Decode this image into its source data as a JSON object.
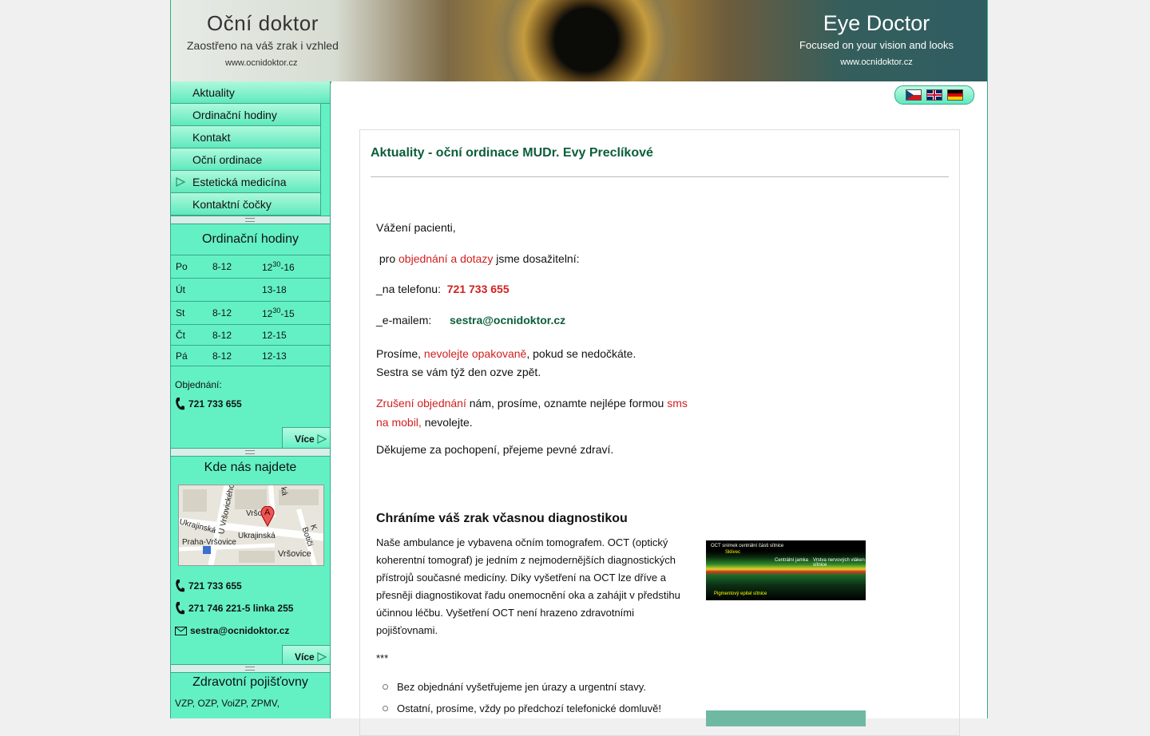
{
  "banner": {
    "left_title": "Oční doktor",
    "left_subtitle": "Zaostřeno na váš zrak i vzhled",
    "left_url": "www.ocnidoktor.cz",
    "right_title": "Eye Doctor",
    "right_subtitle": "Focused on your vision and looks",
    "right_url": "www.ocnidoktor.cz"
  },
  "menu": {
    "items": [
      {
        "label": "Aktuality"
      },
      {
        "label": "Ordinační hodiny"
      },
      {
        "label": "Kontakt"
      },
      {
        "label": "Oční ordinace"
      },
      {
        "label": "Estetická medicína"
      },
      {
        "label": "Kontaktní čočky"
      }
    ]
  },
  "hours_box": {
    "title": "Ordinační hodiny",
    "rows": [
      {
        "day": "Po",
        "morning": "8-12",
        "afternoon_base": "12",
        "afternoon_sup": "30",
        "afternoon_end": "-16"
      },
      {
        "day": "Út",
        "morning": "",
        "afternoon_base": "13-18",
        "afternoon_sup": "",
        "afternoon_end": ""
      },
      {
        "day": "St",
        "morning": "8-12",
        "afternoon_base": "12",
        "afternoon_sup": "30",
        "afternoon_end": "-15"
      },
      {
        "day": "Čt",
        "morning": "8-12",
        "afternoon_base": "12-15",
        "afternoon_sup": "",
        "afternoon_end": ""
      },
      {
        "day": "Pá",
        "morning": "8-12",
        "afternoon_base": "12-13",
        "afternoon_sup": "",
        "afternoon_end": ""
      }
    ],
    "order_label": "Objednání:",
    "order_phone": "721 733 655",
    "more_label": "Více"
  },
  "location_box": {
    "title": "Kde nás najdete",
    "map_labels": {
      "street1": "U Vršovického",
      "street2": "Vršo",
      "street3": "Ukrajinská",
      "street4": "Ukrajinská",
      "street5": "Praha-Vršovice",
      "street6": "Vršovice",
      "street7": "K Botiči",
      "street8": "ká",
      "marker": "A"
    },
    "phone1": "721 733 655",
    "phone2": "271 746 221-5 linka 255",
    "email": "sestra@ocnidoktor.cz",
    "more_label": "Více"
  },
  "insurance_box": {
    "title": "Zdravotní pojišťovny",
    "text": "VZP, OZP, VoiZP, ZPMV,"
  },
  "main": {
    "heading": "Aktuality - oční ordinace MUDr. Evy Preclíkové",
    "greeting": "Vážení pacienti,",
    "reach_pre": " pro ",
    "reach_red": "objednání a dotazy",
    "reach_post": " jsme dosažitelní:",
    "phone_label": "_na telefonu:",
    "phone_value": "721 733 655",
    "email_label": "_e-mailem:",
    "email_value": "sestra@ocnidoktor.cz",
    "please_pre": "Prosíme, ",
    "please_red": "nevolejte opakovaně",
    "please_post": ", pokud se nedočkáte.",
    "callback": "Sestra se vám týž den ozve zpět.",
    "cancel_red": "Zrušení objednání",
    "cancel_mid": " nám, prosíme, oznamte nejlépe formou ",
    "cancel_red2": "sms na mobil,",
    "cancel_post": " nevolejte.",
    "thanks": "Děkujeme za pochopení, přejeme pevné zdraví.",
    "section_title": "Chráníme váš zrak včasnou diagnostikou",
    "section_text": "Naše ambulance je vybavena očním tomografem. OCT (optický koherentní tomograf) je jedním z nejmodernějších diagnostických přístrojů současné medicíny. Díky vyšetření na OCT lze dříve a přesněji diagnostikovat řadu onemocnění oka a zahájit v předstihu účinnou léčbu. Vyšetření OCT není hrazeno zdravotními pojišťovnami.",
    "separator": "***",
    "bullets": [
      "Bez objednání vyšetřujeme jen úrazy a urgentní stavy.",
      "Ostatní, prosíme, vždy po předchozí telefonické domluvě!"
    ],
    "oct_labels": {
      "a": "OCT snímek centrální části sítnice",
      "b": "Sklivec",
      "c": "Centrální jamka",
      "d": "Vrstva nervových vláken sítnice",
      "e": "Pigmentový epitel sítnice"
    }
  },
  "colors": {
    "accent": "#63f1c4",
    "border": "#3aa88a",
    "heading": "#0b5e3a",
    "red": "#d21f1f"
  }
}
